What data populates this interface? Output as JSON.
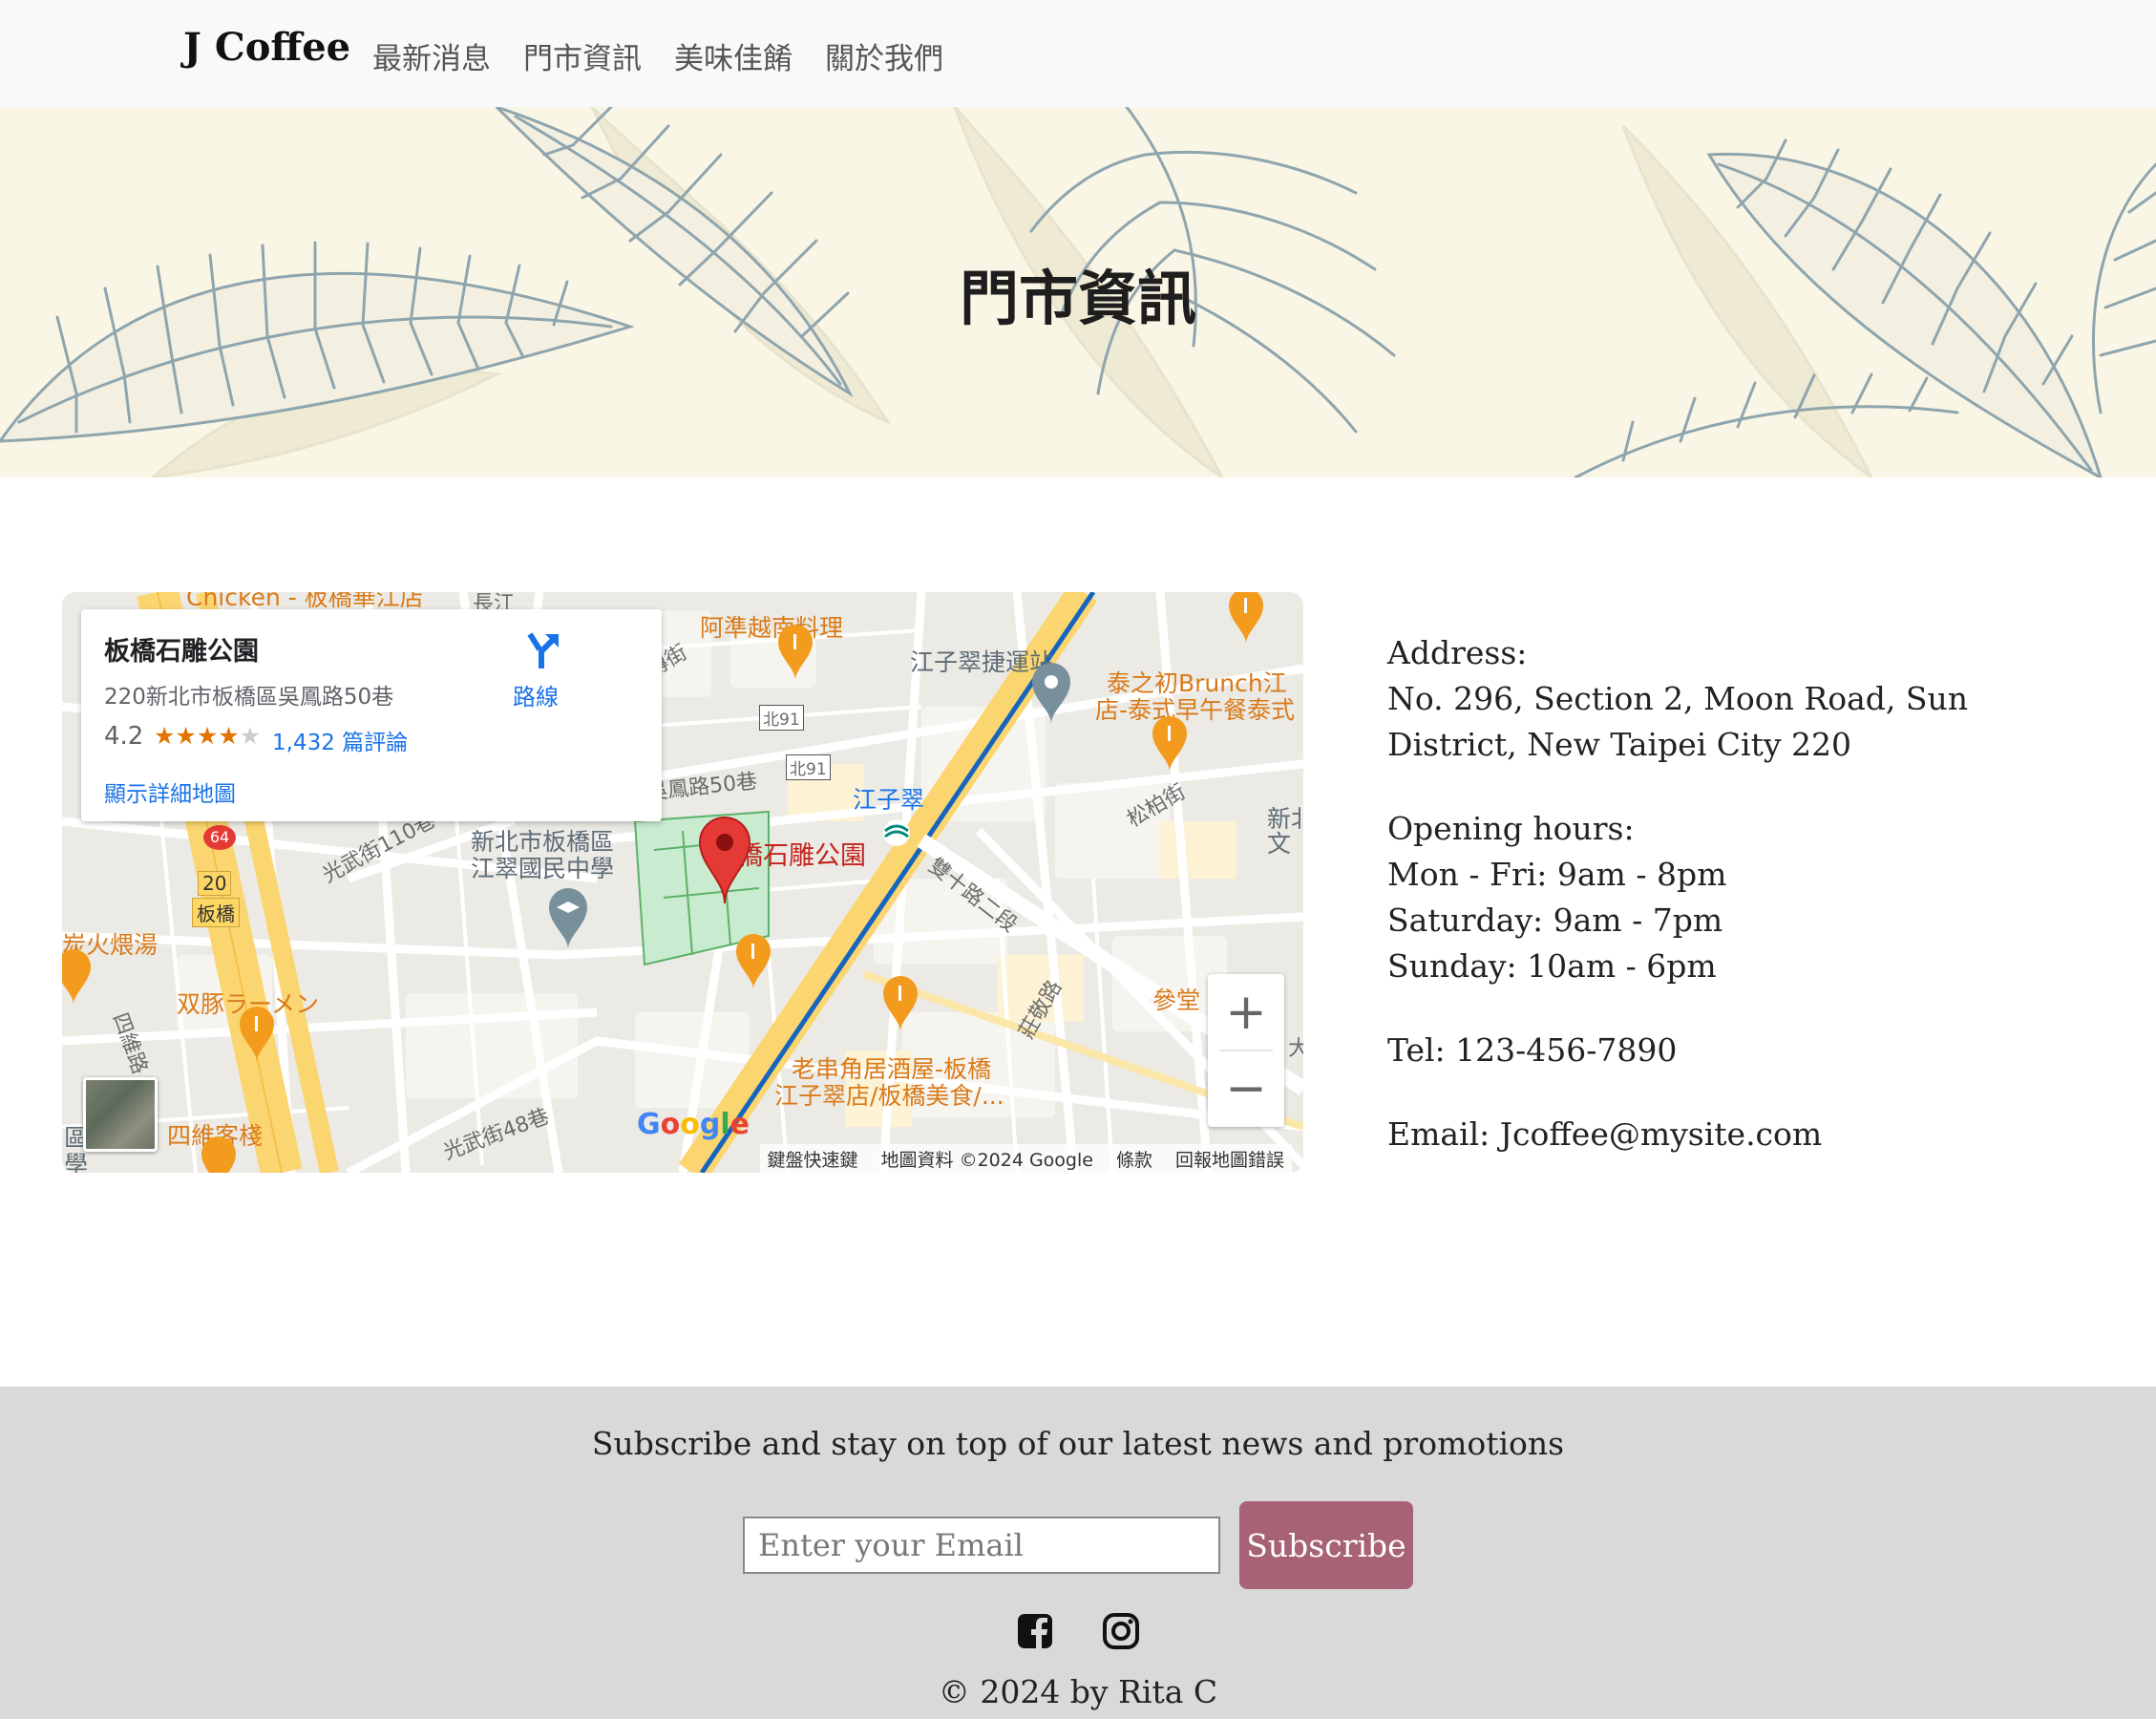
{
  "navbar": {
    "brand": "J Coffee",
    "links": [
      "最新消息",
      "門市資訊",
      "美味佳餚",
      "關於我們"
    ]
  },
  "hero": {
    "title": "門市資訊"
  },
  "map": {
    "card": {
      "title": "板橋石雕公園",
      "address": "220新北市板橋區吳鳳路50巷",
      "rating": "4.2",
      "stars": "★★★★",
      "stars_dim": "★",
      "reviews": "1,432 篇評論",
      "directions": "路線",
      "larger_map": "顯示詳細地圖"
    },
    "labels": {
      "chicken": "Chicken - 板橋華江店",
      "vietnam": "阿準越南料理",
      "mingchuan": "銘傳街",
      "mrt": "江子翠捷運站",
      "brunch1": "泰之初Brunch江",
      "brunch2": "店-泰式早午餐泰式",
      "north91a": "北91",
      "north91b": "北91",
      "wufeng": "吳鳳路50巷",
      "jiangzicui": "江子翠",
      "songbo": "松柏街",
      "xinbei": "新北",
      "wen": "文",
      "school1": "新北市板橋區",
      "school2": "江翠國民中學",
      "park": "板橋石雕公園",
      "shuangshi": "雙十路二段",
      "guangwu110": "光武街110巷",
      "tanhuo": "炭火煨湯",
      "ramen": "双豚ラーメン",
      "siwei": "四維路",
      "siweiinn": "四維客棧",
      "guangwu48": "光武街48巷",
      "izakaya1": "老串角居酒屋-板橋",
      "izakaya2": "江子翠店/板橋美食/...",
      "zhuangjing": "莊敬路",
      "cantang": "參堂",
      "road64": "64",
      "road20": "20",
      "banqiao": "板橋",
      "qu": "區",
      "xue": "學",
      "chang": "長江",
      "dajie": "大"
    },
    "zoom_in": "+",
    "zoom_out": "−",
    "google": [
      "G",
      "o",
      "o",
      "g",
      "l",
      "e"
    ],
    "attribution": [
      "鍵盤快速鍵",
      "地圖資料 ©2024 Google",
      "條款",
      "回報地圖錯誤"
    ]
  },
  "info": {
    "address_label": "Address:",
    "address": "No. 296, Section 2, Moon Road, Sun District, New Taipei City 220",
    "hours_label": "Opening hours:",
    "hours": [
      "Mon - Fri: 9am - 8pm",
      "Saturday: 9am - 7pm",
      "Sunday: 10am - 6pm"
    ],
    "tel": "Tel: 123-456-7890",
    "email": "Email: Jcoffee@mysite.com"
  },
  "footer": {
    "subscribe_text": "Subscribe and stay on top of our latest news and promotions",
    "email_placeholder": "Enter your Email",
    "subscribe_button": "Subscribe",
    "social_icons": [
      "facebook-icon",
      "instagram-icon"
    ],
    "copyright": "© 2024 by Rita C"
  },
  "colors": {
    "navbar_bg": "#f8f9fa",
    "hero_bg": "#faf6e6",
    "leaf_stroke": "#8fa5ad",
    "subscribe_button": "#a86276",
    "footer_bg": "#d9d9d9"
  }
}
